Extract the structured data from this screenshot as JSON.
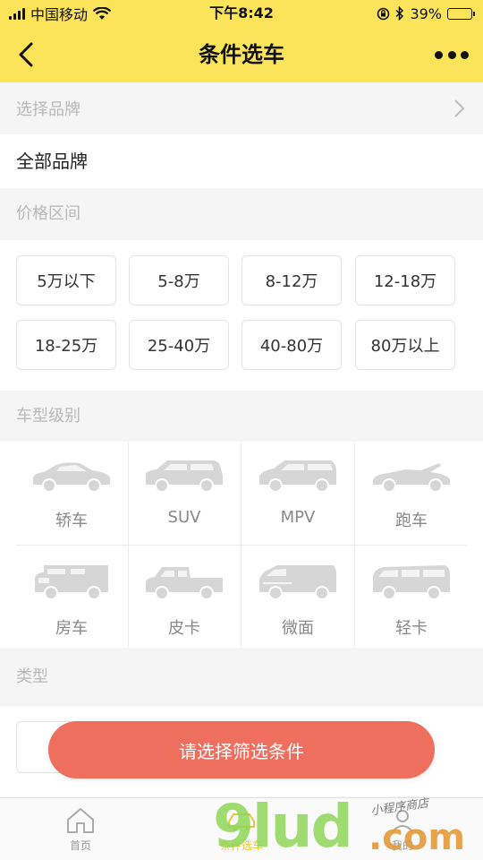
{
  "status_bar": {
    "carrier": "中国移动",
    "time": "下午8:42",
    "battery_percent": "39%",
    "battery_level": 0.39
  },
  "nav": {
    "title": "条件选车"
  },
  "brand": {
    "label": "选择品牌",
    "value": "全部品牌"
  },
  "price": {
    "label": "价格区间",
    "options": [
      "5万以下",
      "5-8万",
      "8-12万",
      "12-18万",
      "18-25万",
      "25-40万",
      "40-80万",
      "80万以上"
    ]
  },
  "car_type": {
    "label": "车型级别",
    "items": [
      {
        "label": "轿车",
        "icon": "sedan-icon"
      },
      {
        "label": "SUV",
        "icon": "suv-icon"
      },
      {
        "label": "MPV",
        "icon": "mpv-icon"
      },
      {
        "label": "跑车",
        "icon": "sports-car-icon"
      },
      {
        "label": "房车",
        "icon": "rv-icon"
      },
      {
        "label": "皮卡",
        "icon": "pickup-icon"
      },
      {
        "label": "微面",
        "icon": "minivan-icon"
      },
      {
        "label": "轻卡",
        "icon": "light-truck-icon"
      }
    ]
  },
  "kind": {
    "label": "类型"
  },
  "submit": {
    "label": "请选择筛选条件"
  },
  "tabs": [
    {
      "label": "首页",
      "icon": "home-icon"
    },
    {
      "label": "条件选车",
      "icon": "car-filter-icon",
      "active": true
    },
    {
      "label": "我的",
      "icon": "user-icon"
    }
  ],
  "watermark": {
    "brand": "9lud",
    "suffix": ".com",
    "handwriting": "小程序商店"
  },
  "colors": {
    "header": "#fce45a",
    "accent_button": "#ef6f5f",
    "icon_gray": "#d0d0d0"
  }
}
